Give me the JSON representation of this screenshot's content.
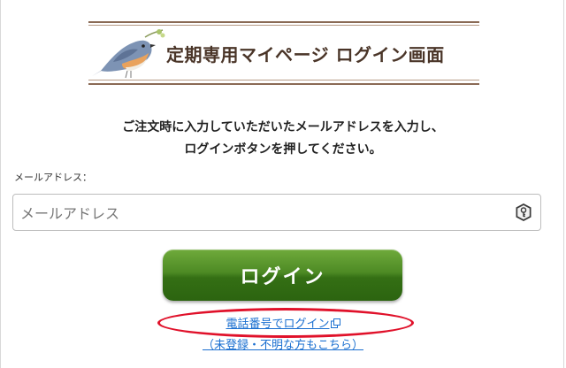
{
  "banner": {
    "title": "定期専用マイページ ログイン画面"
  },
  "instructions": {
    "line1": "ご注文時に入力していただいたメールアドレスを入力し、",
    "line2": "ログインボタンを押してください。"
  },
  "email": {
    "label": "メールアドレス：",
    "placeholder": "メールアドレス",
    "value": ""
  },
  "login_button": {
    "label": "ログイン"
  },
  "phone_login": {
    "link_text": "電話番号でログイン",
    "sub_text": "（未登録・不明な方もこちら）"
  },
  "colors": {
    "button_green": "#4d8a24",
    "link_blue": "#1a6fd0",
    "highlight_red": "#e0112a",
    "title_brown": "#4a3528"
  },
  "icons": {
    "bird": "bird-illustration",
    "key": "key-icon",
    "external": "external-link-icon"
  }
}
